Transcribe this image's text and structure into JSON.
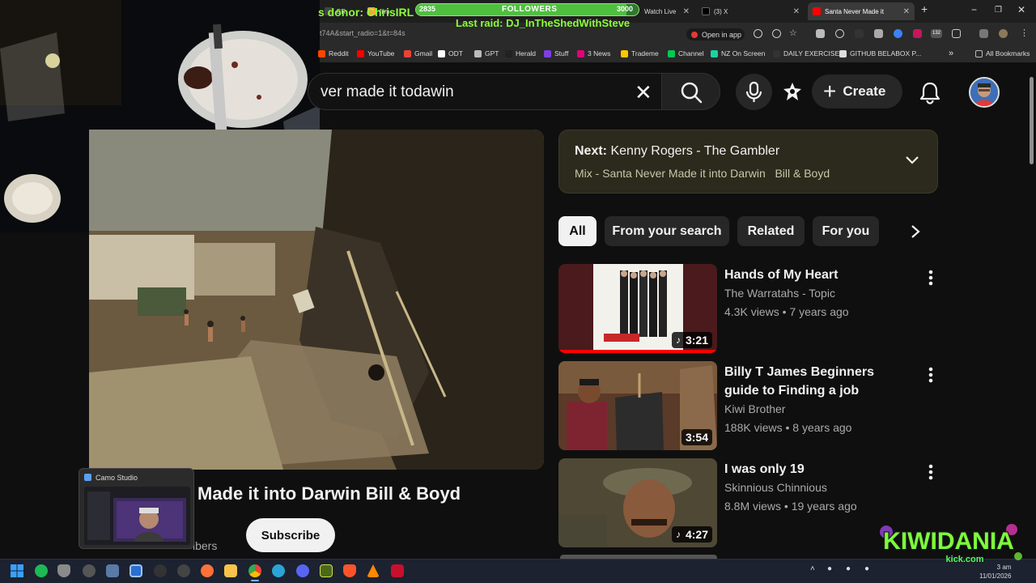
{
  "browser": {
    "tabs": [
      {
        "label": "BR"
      },
      {
        "label": "film"
      },
      {
        "label": "Watch Live"
      },
      {
        "label": "(3) X"
      },
      {
        "label": "Santa Never Made it"
      }
    ],
    "url_fragment": "t74A&start_radio=1&t=84s",
    "open_in_app": "Open in app",
    "extension_badge": "132",
    "bookmarks": [
      {
        "label": "Reddit",
        "color": "#ff4500"
      },
      {
        "label": "YouTube",
        "color": "#ff0000"
      },
      {
        "label": "Gmail",
        "color": "#ea4335"
      },
      {
        "label": "ODT",
        "color": "#ffffff"
      },
      {
        "label": "GPT",
        "color": "#bbbbbb"
      },
      {
        "label": "Herald",
        "color": "#222222"
      },
      {
        "label": "Stuff",
        "color": "#7b3fe4"
      },
      {
        "label": "3 News",
        "color": "#e4007c"
      },
      {
        "label": "Trademe",
        "color": "#ffc600"
      },
      {
        "label": "Channel",
        "color": "#00c853"
      },
      {
        "label": "NZ On Screen",
        "color": "#1dd1a1"
      },
      {
        "label": "DAILY EXERCISE!",
        "color": "#333333"
      },
      {
        "label": "GITHUB BELABOX P...",
        "color": "#dddddd"
      }
    ],
    "all_bookmarks": "All Bookmarks"
  },
  "overlay": {
    "donor": "s donor: ChrisIRL",
    "followers_current": "2835",
    "followers_label": "FOLLOWERS",
    "followers_goal": "3000",
    "followers_progress": 0.945,
    "last_raid": "Last raid: DJ_InTheShedWithSteve",
    "camo_label": "Camo Studio",
    "brand_line1": "KIWIDANIA",
    "brand_line2": "kick.com"
  },
  "youtube": {
    "search_value": "ver made it todawin",
    "create_label": "Create",
    "video_title_visible": "Made it into Darwin Bill & Boyd",
    "subscribers_partial": "ibers",
    "subscribe_label": "Subscribe",
    "next": {
      "prefix": "Next:",
      "title": "Kenny Rogers - The Gambler",
      "mix": "Mix - Santa Never Made it into Darwin",
      "mix_artist": "Bill & Boyd"
    },
    "chips": [
      "All",
      "From your search",
      "Related",
      "For you"
    ],
    "recommendations": [
      {
        "title": "Hands of My Heart",
        "channel": "The Warratahs - Topic",
        "views": "4.3K views",
        "age": "7 years ago",
        "duration": "3:21",
        "music": true,
        "watched": true
      },
      {
        "title": "Billy T James Beginners guide to Finding a job",
        "channel": "Kiwi Brother",
        "views": "188K views",
        "age": "8 years ago",
        "duration": "3:54",
        "music": false,
        "watched": false
      },
      {
        "title": "I was only 19",
        "channel": "Skinnious Chinnious",
        "views": "8.8M views",
        "age": "19 years ago",
        "duration": "4:27",
        "music": true,
        "watched": false
      }
    ],
    "separator": "•"
  },
  "taskbar": {
    "clock_time": "3 am",
    "clock_date": "11/01/2026"
  },
  "colors": {
    "accent_red": "#ff0000",
    "overlay_green": "#8cff3a"
  }
}
